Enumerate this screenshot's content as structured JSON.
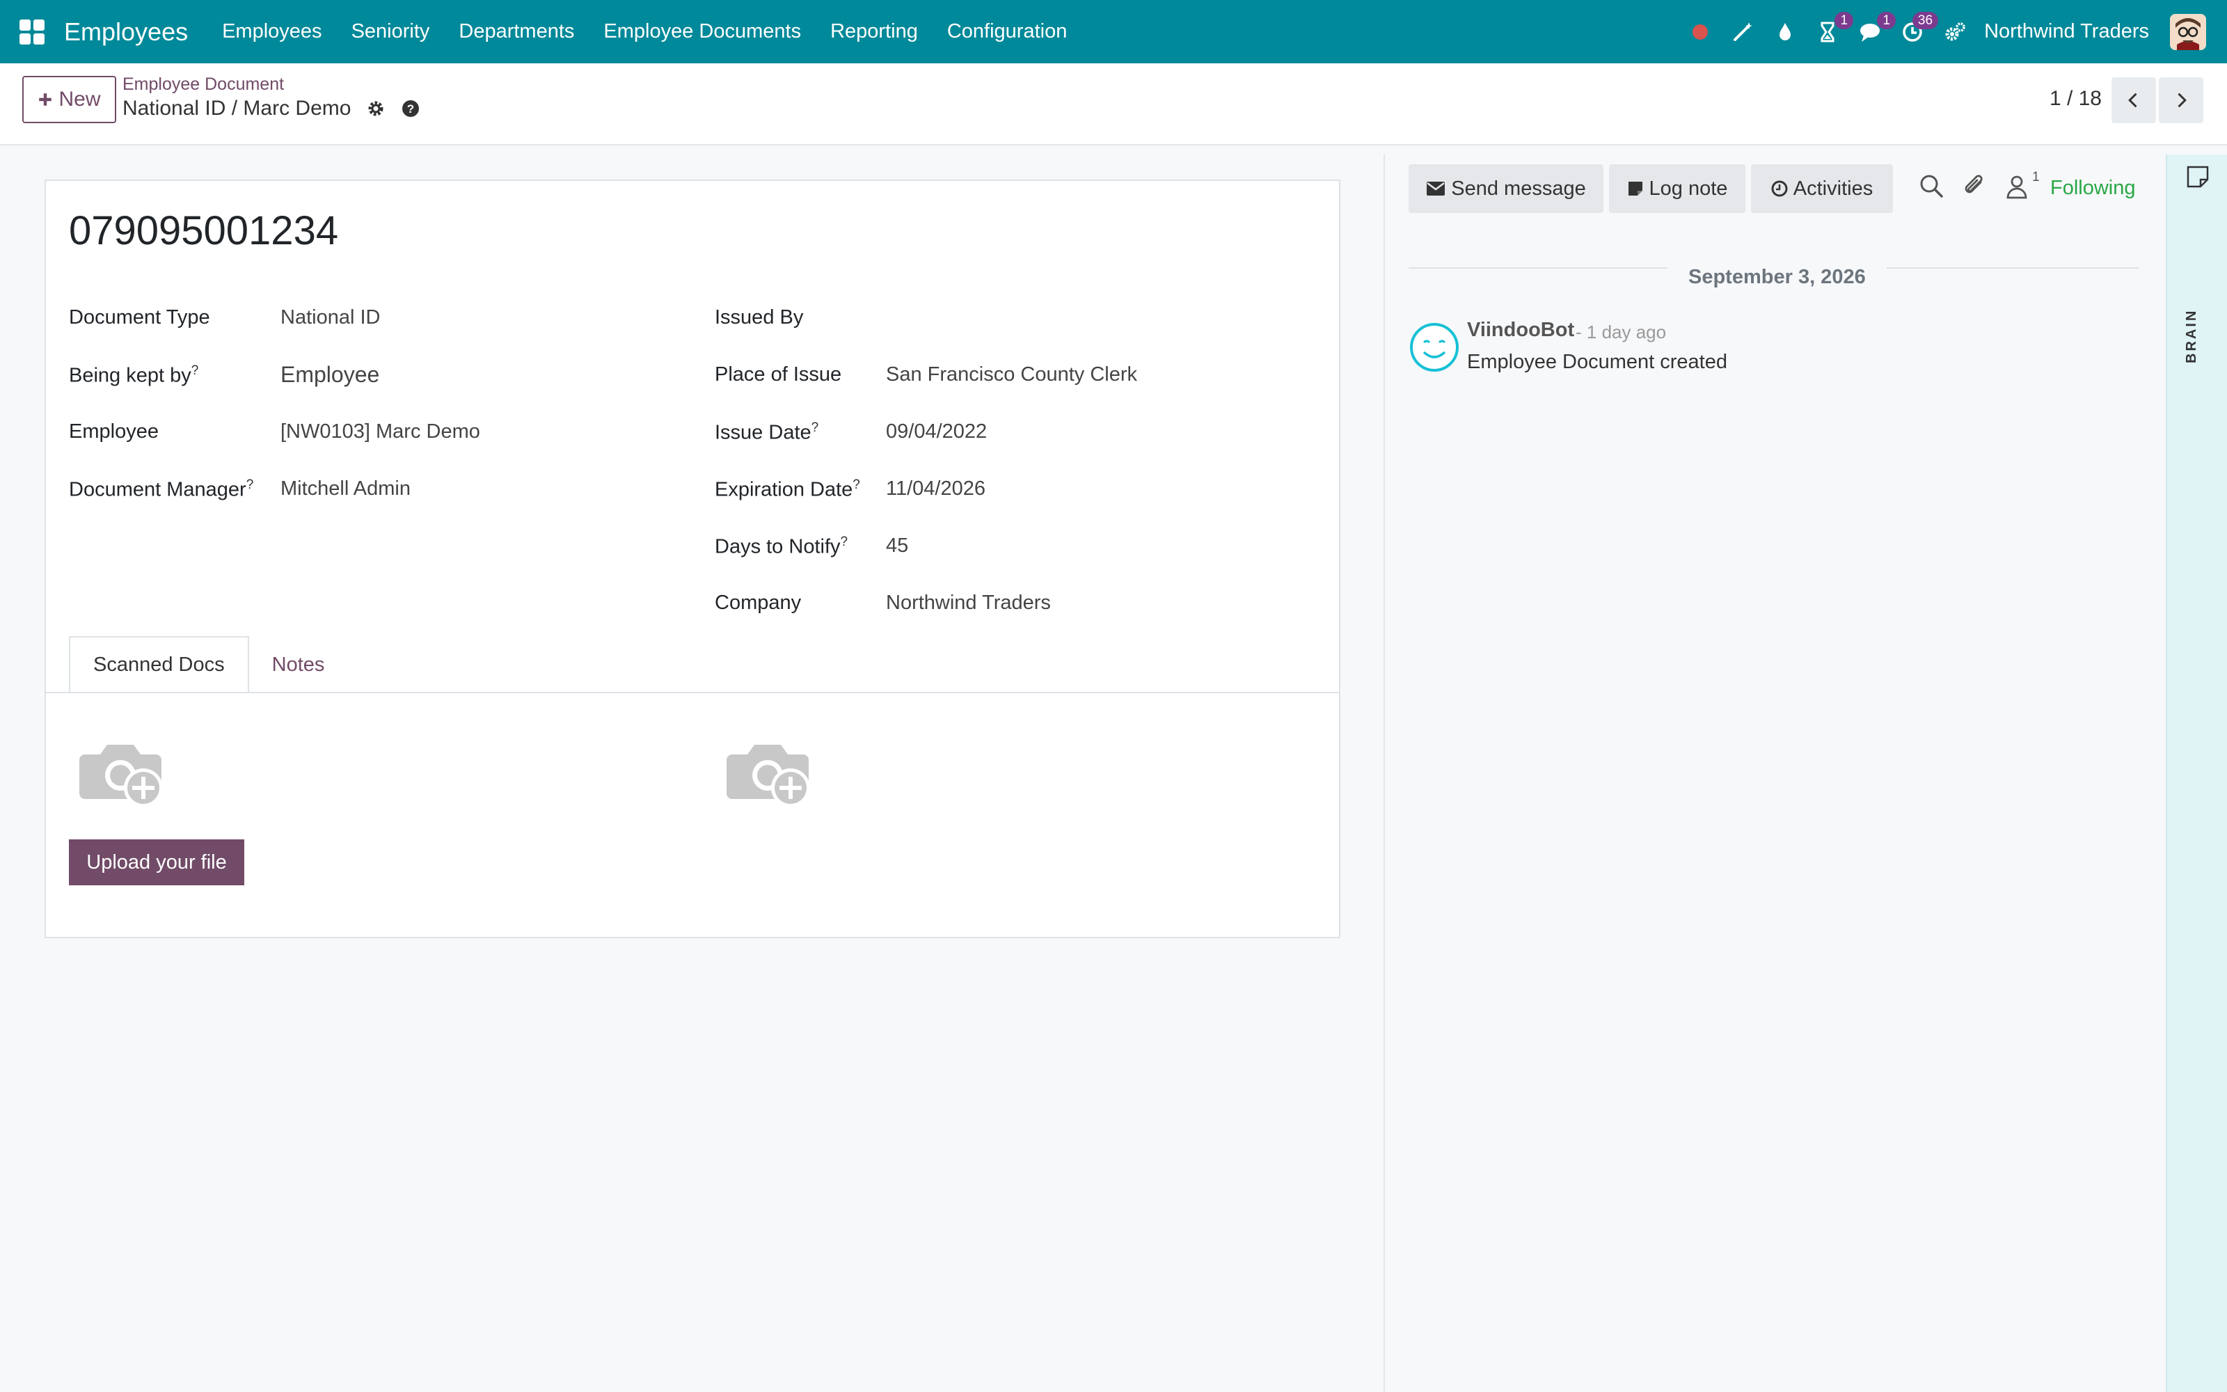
{
  "navbar": {
    "app_title": "Employees",
    "menu": [
      "Employees",
      "Seniority",
      "Departments",
      "Employee Documents",
      "Reporting",
      "Configuration"
    ],
    "badges": {
      "activity": "1",
      "messages": "1",
      "timer": "36"
    },
    "company": "Northwind Traders"
  },
  "control_panel": {
    "new_label": "New",
    "breadcrumb_parent": "Employee Document",
    "breadcrumb_current": "National ID / Marc Demo",
    "pager": "1 / 18"
  },
  "form": {
    "title": "079095001234",
    "left_fields": [
      {
        "label": "Document Type",
        "value": "National ID",
        "help": ""
      },
      {
        "label": "Being kept by",
        "value": "Employee",
        "help": "?"
      },
      {
        "label": "Employee",
        "value": "[NW0103] Marc Demo",
        "help": ""
      },
      {
        "label": "Document Manager",
        "value": "Mitchell Admin",
        "help": "?"
      }
    ],
    "right_fields": [
      {
        "label": "Issued By",
        "value": "",
        "help": ""
      },
      {
        "label": "Place of Issue",
        "value": "San Francisco County Clerk",
        "help": ""
      },
      {
        "label": "Issue Date",
        "value": "09/04/2022",
        "help": "?"
      },
      {
        "label": "Expiration Date",
        "value": "11/04/2026",
        "help": "?"
      },
      {
        "label": "Days to Notify",
        "value": "45",
        "help": "?"
      },
      {
        "label": "Company",
        "value": "Northwind Traders",
        "help": ""
      }
    ],
    "tabs": [
      "Scanned Docs",
      "Notes"
    ],
    "upload_label": "Upload your file"
  },
  "chatter": {
    "send_message": "Send message",
    "log_note": "Log note",
    "activities": "Activities",
    "follower_count": "1",
    "following": "Following",
    "date": "September 3, 2026",
    "message": {
      "author": "ViindooBot",
      "time": "- 1 day ago",
      "body": "Employee Document created"
    }
  },
  "side_panel": {
    "label": "BRAIN"
  },
  "colors": {
    "navbar": "#00899a",
    "primary": "#714b67",
    "following": "#28a745"
  }
}
